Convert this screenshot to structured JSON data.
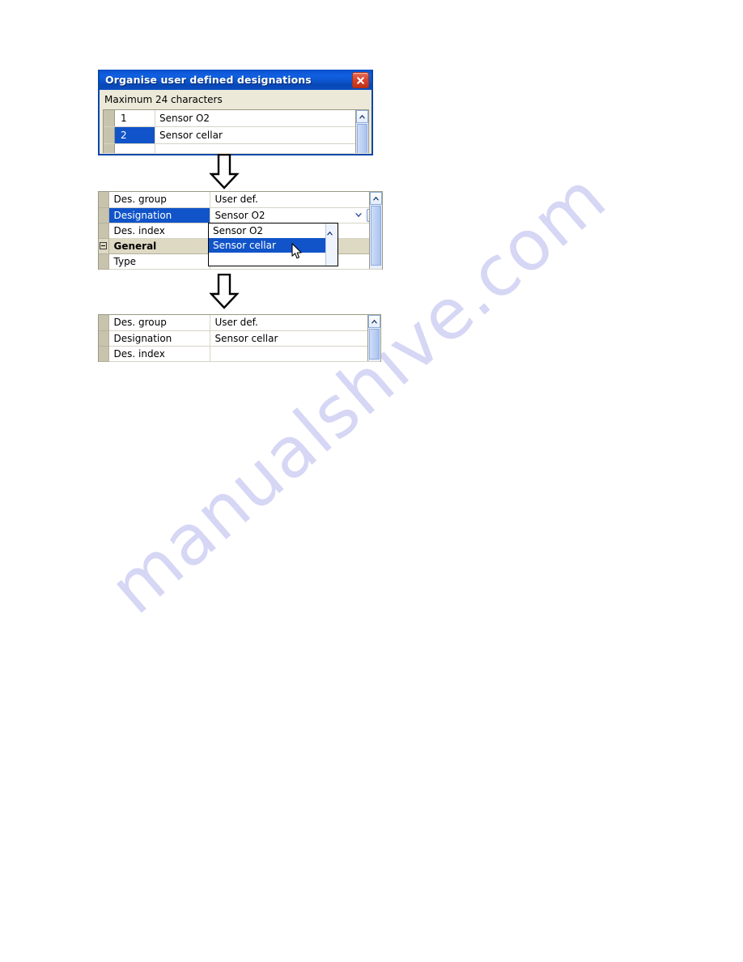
{
  "watermark": {
    "text": "manualshive.com"
  },
  "dialog": {
    "title": "Organise user defined designations",
    "close_label": "close-icon",
    "subtitle": "Maximum 24 characters",
    "list": {
      "rows": [
        {
          "number": "1",
          "name": "Sensor O2",
          "selected": false
        },
        {
          "number": "2",
          "name": "Sensor cellar",
          "selected": true
        }
      ]
    },
    "scrollbar": {
      "up_arrow": "scroll-up-arrow"
    }
  },
  "arrows": {
    "first": "down-block-arrow",
    "second": "down-block-arrow"
  },
  "step_middle": {
    "rows": [
      {
        "label": "Des. group",
        "value": "User def.",
        "label_selected": false
      },
      {
        "label": "Designation",
        "value": "Sensor O2",
        "label_selected": true
      },
      {
        "label": "Des. index",
        "value": "",
        "label_selected": false
      }
    ],
    "group_row": {
      "label": "General"
    },
    "type_row": {
      "label": "Type",
      "value": ""
    },
    "combo": {
      "chevron": "chevron-down-icon",
      "browse_label": "...",
      "options": [
        {
          "label": "Sensor O2",
          "selected": false
        },
        {
          "label": "Sensor cellar",
          "selected": true
        }
      ]
    },
    "scrollbar": {
      "up_arrow": "scroll-up-arrow"
    }
  },
  "step_bottom": {
    "rows": [
      {
        "label": "Des. group",
        "value": "User def."
      },
      {
        "label": "Designation",
        "value": "Sensor cellar"
      },
      {
        "label": "Des. index",
        "value": ""
      }
    ],
    "scrollbar": {
      "up_arrow": "scroll-up-arrow"
    }
  },
  "colors": {
    "title_blue": "#0d56d6",
    "selection_blue": "#1154c9",
    "close_red": "#c32f16",
    "dialog_face": "#ece9d8",
    "group_row": "#ded9c3",
    "gutter": "#c7c3ad",
    "watermark": "#d6d6f5"
  }
}
